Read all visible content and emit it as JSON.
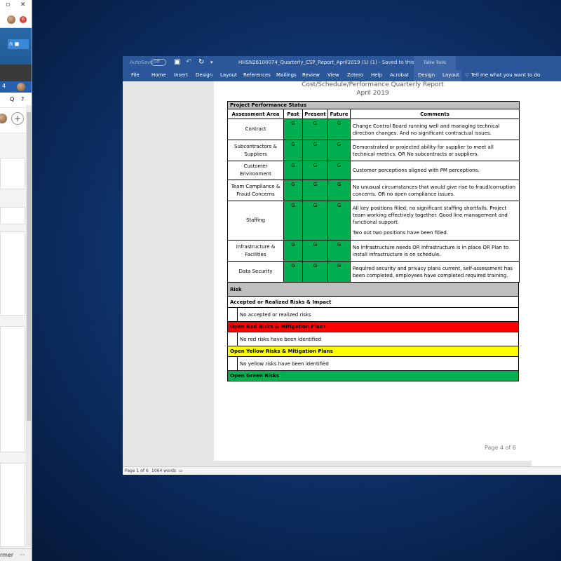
{
  "background_window": {
    "controls": [
      "▫",
      "✕"
    ],
    "banner_pill": "n",
    "badge": "4",
    "badge2": "6",
    "icons": [
      "Q",
      "?"
    ],
    "plus": "+",
    "bottom_text": "rmer",
    "bottom_more": "···"
  },
  "word": {
    "autosave_label": "AutoSave",
    "autosave_state": "Off",
    "doc_title": "HHSN26100074_Quarterly_CSP_Report_April2019 (1) (1)  -  Saved to this PC",
    "contextual_group": "Table Tools",
    "tabs": [
      "File",
      "Home",
      "Insert",
      "Design",
      "Layout",
      "References",
      "Mailings",
      "Review",
      "View",
      "Zotero",
      "Help",
      "Acrobat",
      "Design",
      "Layout"
    ],
    "tell_me": "Tell me what you want to do",
    "status_page": "Page 1 of 6",
    "status_words": "1064 words"
  },
  "report": {
    "title": "Cost/Schedule/Performance Quarterly Report",
    "date": "April 2019",
    "table_title": "Project Performance Status",
    "columns": [
      "Assessment Area",
      "Past",
      "Present",
      "Future",
      "Comments"
    ],
    "rows": [
      {
        "area": "Contract",
        "past": "G",
        "present": "G",
        "future": "G",
        "comments": [
          "Change Control Board running well and managing technical direction changes. And no significant contractual issues."
        ]
      },
      {
        "area": "Subcontractors & Suppliers",
        "past": "G",
        "present": "G",
        "future": "G",
        "comments": [
          "Demonstrated or projected ability for supplier to meet all technical metrics. OR No subcontracts or suppliers."
        ]
      },
      {
        "area": "Customer Environment",
        "past": "G",
        "present": "G",
        "future": "G",
        "comments": [
          "Customer perceptions aligned with PM perceptions."
        ]
      },
      {
        "area": "Team Compliance & Fraud Concerns",
        "past": "G",
        "present": "G",
        "future": "G",
        "comments": [
          "No unusual circumstances that would give rise to fraud/corruption concerns. OR no open compliance issues."
        ]
      },
      {
        "area": "Staffing",
        "past": "G",
        "present": "G",
        "future": "G",
        "comments": [
          "All key positions filled; no significant staffing shortfalls. Project team working effectively together. Good line management and functional support.",
          "Two out two positions have been filled."
        ]
      },
      {
        "area": "Infrastructure & Facilities",
        "past": "G",
        "present": "G",
        "future": "G",
        "comments": [
          "No Infrastructure needs OR Infrastructure is in place OR Plan to install infrastructure is on schedule."
        ]
      },
      {
        "area": "Data Security",
        "past": "G",
        "present": "G",
        "future": "G",
        "comments": [
          "Required security and privacy plans current, self-assessment has been completed, employees have completed required training."
        ]
      }
    ],
    "risk": {
      "title": "Risk",
      "accepted_header": "Accepted or Realized Risks & Impact",
      "accepted_body": "No accepted or realized risks",
      "red_header": "Open Red Risks & Mitigation Plans",
      "red_body": "No red risks have been identified",
      "yellow_header": "Open Yellow Risks & Mitigation Plans",
      "yellow_body": "No yellow risks have been identified",
      "green_header": "Open Green Risks"
    },
    "page_number": "Page 4 of 6"
  },
  "colors": {
    "word_blue": "#2b579a",
    "status_green": "#00b050",
    "risk_red": "#ff0000",
    "risk_yellow": "#ffff00",
    "header_gray": "#bfbfbf"
  }
}
